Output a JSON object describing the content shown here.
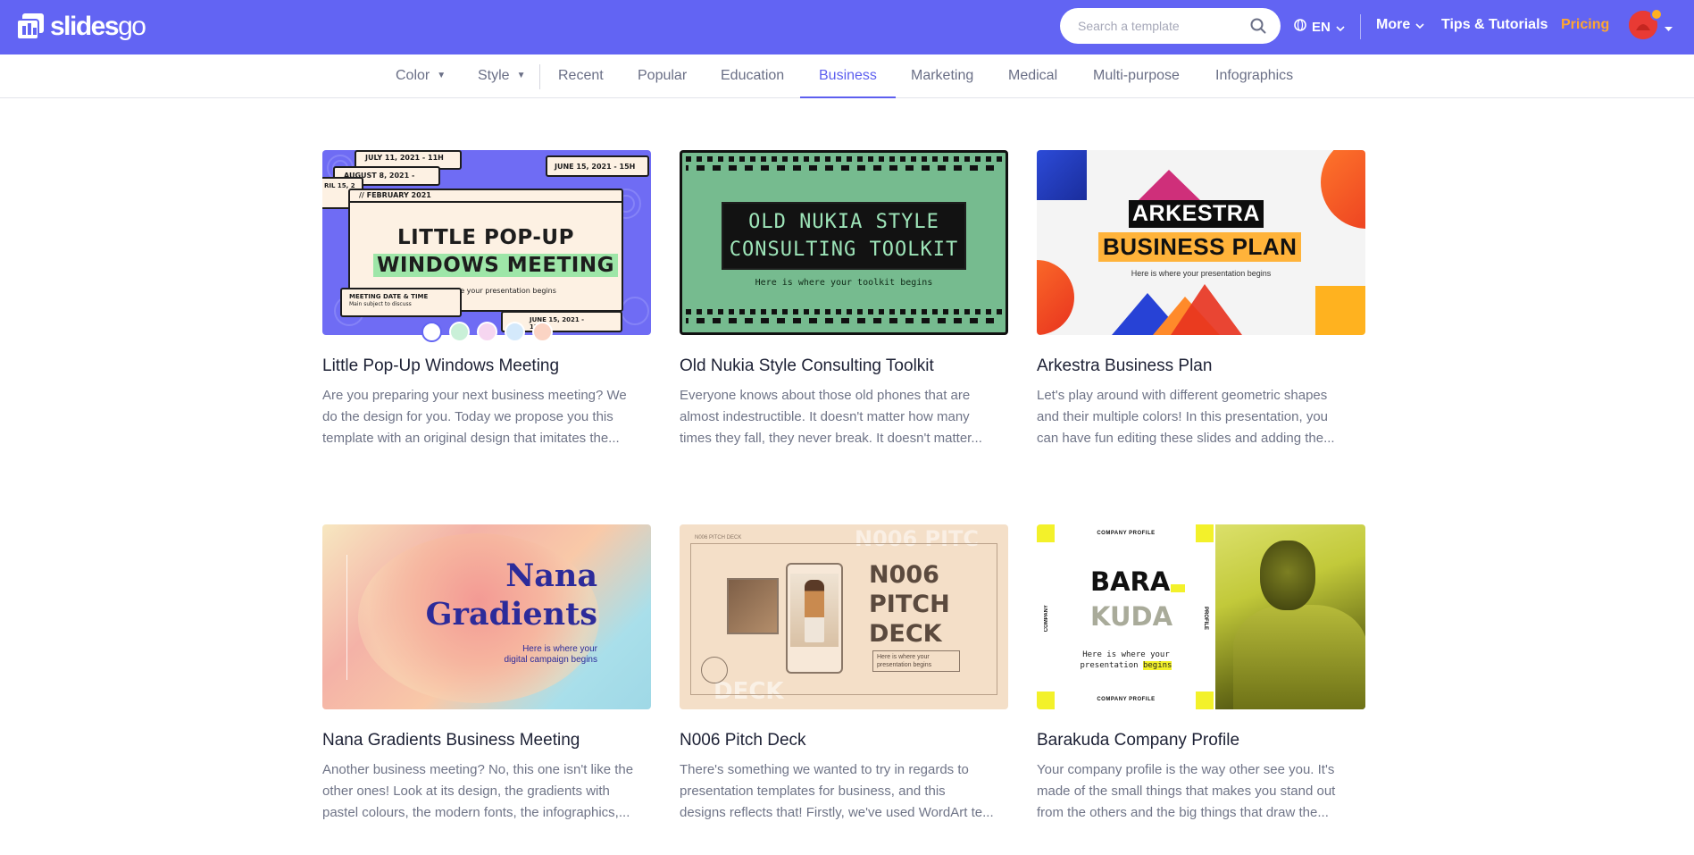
{
  "header": {
    "brand": {
      "name_bold": "slides",
      "name_light": "go"
    },
    "search": {
      "placeholder": "Search a template"
    },
    "language": "EN",
    "nav": {
      "more": "More",
      "tips": "Tips & Tutorials",
      "pricing": "Pricing"
    }
  },
  "categories": {
    "filters": [
      "Color",
      "Style"
    ],
    "items": [
      "Recent",
      "Popular",
      "Education",
      "Business",
      "Marketing",
      "Medical",
      "Multi-purpose",
      "Infographics"
    ],
    "active": "Business"
  },
  "colors": {
    "header_bg": "#6264f3",
    "accent": "#5d5fef",
    "pricing": "#ffa630"
  },
  "cards": [
    {
      "title": "Little Pop-Up Windows Meeting",
      "desc": [
        "Are you preparing your next business meeting? We",
        "do the design for you. Today we propose you this",
        "template with an original design that imitates the..."
      ],
      "thumb": {
        "line1": "LITTLE POP-UP",
        "line2": "WINDOWS MEETING",
        "sub": "Here is where your presentation begins",
        "date_back": "JULY 11, 2021 - 11H",
        "date_back2": "AUGUST 8, 2021 - 14H",
        "date_right": "JUNE 15, 2021 - 15H",
        "date_left": "RIL 15, 2",
        "window_label": "// FEBRUARY 2021",
        "meeting_title": "MEETING DATE & TIME",
        "meeting_sub": "Main subject to discuss",
        "date_bottom": "JUNE 15, 2021 - 15H"
      },
      "color_options": [
        "#ffffff",
        "#c9f0d8",
        "#f6d6f0",
        "#d4e9fb",
        "#fbd4c4"
      ]
    },
    {
      "title": "Old Nukia Style Consulting Toolkit",
      "desc": [
        "Everyone knows about those old phones that are",
        "almost indestructible. It doesn't matter how many",
        "times they fall, they never break. It doesn't matter..."
      ],
      "thumb": {
        "line1": "OLD NUKIA STYLE",
        "line2": "CONSULTING TOOLKIT",
        "sub": "Here is where your toolkit begins"
      }
    },
    {
      "title": "Arkestra Business Plan",
      "desc": [
        "Let's play around with different geometric shapes",
        "and their multiple colors! In this presentation, you",
        "can have fun editing these slides and adding the..."
      ],
      "thumb": {
        "line1": "ARKESTRA",
        "line2": "BUSINESS PLAN",
        "sub": "Here is where your presentation begins"
      }
    },
    {
      "title": "Nana Gradients Business Meeting",
      "desc": [
        "Another business meeting? No, this one isn't like the",
        "other ones! Look at its design, the gradients with",
        "pastel colours, the modern fonts, the infographics,..."
      ],
      "thumb": {
        "line1": "Nana",
        "line2": "Gradients",
        "sub1": "Here is where your",
        "sub2": "digital campaign begins"
      }
    },
    {
      "title": "N006 Pitch Deck",
      "desc": [
        "There's something we wanted to try in regards to",
        "presentation templates for business, and this",
        "designs reflects that! Firstly, we've used WordArt te..."
      ],
      "thumb": {
        "line1": "N006",
        "line2": "PITCH",
        "line3": "DECK",
        "sub1": "Here is where your",
        "sub2": "presentation begins",
        "small": "N006 PITCH DECK",
        "ghost": "N006 PITC",
        "ghost2": "DECK"
      }
    },
    {
      "title": "Barakuda Company Profile",
      "desc": [
        "Your company profile is the way other see you. It's",
        "made of the small things that makes you stand out",
        "from the others and the big things that draw the..."
      ],
      "thumb": {
        "line1": "BARA",
        "line2": "KUDA",
        "sub1": "Here is where your",
        "sub2a": "presentation ",
        "sub2b": "begins",
        "label": "COMPANY PROFILE",
        "side_left": "COMPANY",
        "side_right": "PROFILE"
      }
    }
  ]
}
